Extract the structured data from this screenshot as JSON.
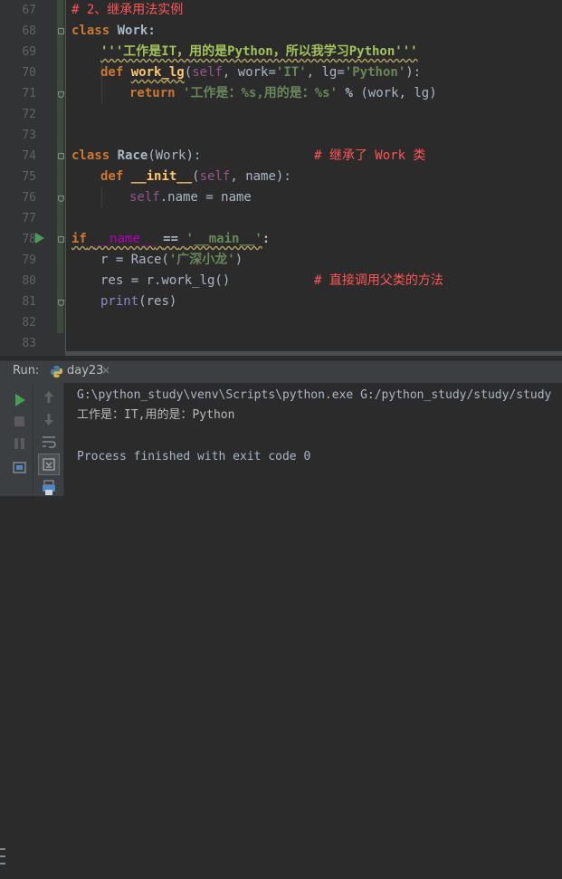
{
  "editor": {
    "line_numbers": [
      "67",
      "68",
      "69",
      "70",
      "71",
      "72",
      "73",
      "74",
      "75",
      "76",
      "77",
      "78",
      "79",
      "80",
      "81",
      "82",
      "83"
    ],
    "comment_67": "# 2、继承用法实例",
    "class_kw": "class",
    "class_work_name": "Work",
    "colon": ":",
    "docstring": "'''工作是IT，用的是Python，所以我学习Python'''",
    "def_kw": "def",
    "method_work_lg": "work_lg",
    "open_paren": "(",
    "self_kw": "self",
    "comma_space": ", ",
    "param_work": "work",
    "eq": "=",
    "str_it": "'IT'",
    "param_lg": "lg",
    "str_python": "'Python'",
    "close_colon": "):",
    "return_kw": "return",
    "fmt_string": "'工作是：%s,用的是：%s'",
    "percent": "%",
    "tuple_open": "(",
    "tuple_work": "work",
    "tuple_lg": "lg",
    "tuple_close": ")",
    "class_race_name": "Race",
    "base_class": "(Work):",
    "comment_74": "# 继承了 Work 类",
    "init_name": "__init__",
    "param_name": "name",
    "self_name_attr": "self",
    "dot_name": ".name = name",
    "if_kw": "if",
    "dunder_name": "__name__",
    "eqeq": "==",
    "str_main": "'__main__'",
    "r_assign": "r = Race(",
    "str_xiaolong": "'广深小龙'",
    "close_paren": ")",
    "res_assign": "res = r.work_lg()",
    "comment_80": "# 直接调用父类的方法",
    "print_kw": "print",
    "print_args": "(res)"
  },
  "run": {
    "label": "Run:",
    "tab_name": "day23",
    "tab_close": "×",
    "console_lines": [
      "G:\\python_study\\venv\\Scripts\\python.exe G:/python_study/study/study",
      "工作是：IT,用的是：Python",
      "",
      "Process finished with exit code 0"
    ]
  },
  "colors": {
    "background": "#2b2b2b",
    "gutter": "#313335",
    "keyword": "#cc7832",
    "function": "#ffc66d",
    "string": "#6a8759",
    "comment": "#ff5555",
    "run_green": "#499c54"
  }
}
